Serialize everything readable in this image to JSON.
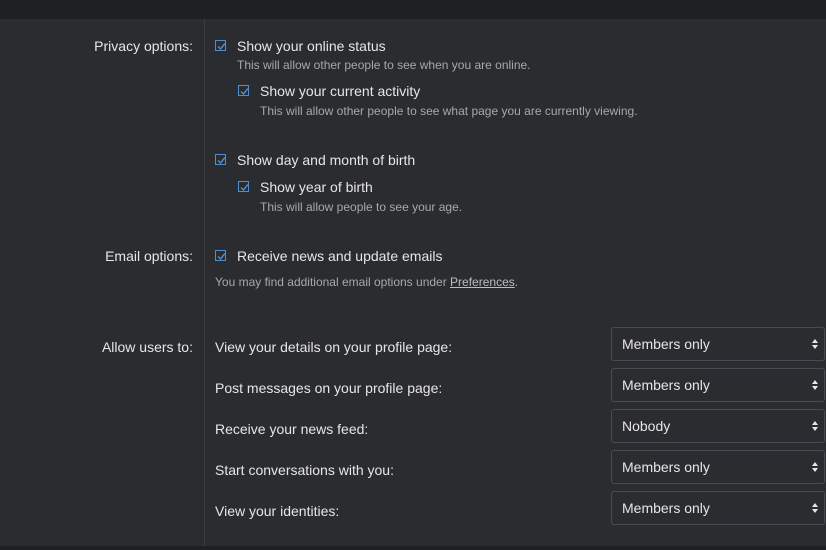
{
  "privacy": {
    "label": "Privacy options:",
    "online_status": "Show your online status",
    "online_status_hint": "This will allow other people to see when you are online.",
    "current_activity": "Show your current activity",
    "current_activity_hint": "This will allow other people to see what page you are currently viewing.",
    "dob": "Show day and month of birth",
    "year": "Show year of birth",
    "year_hint": "This will allow people to see your age."
  },
  "email": {
    "label": "Email options:",
    "news": "Receive news and update emails",
    "hint_prefix": "You may find additional email options under ",
    "hint_link": "Preferences",
    "hint_suffix": "."
  },
  "allow": {
    "label": "Allow users to:",
    "rows": [
      {
        "label": "View your details on your profile page:",
        "value": "Members only"
      },
      {
        "label": "Post messages on your profile page:",
        "value": "Members only"
      },
      {
        "label": "Receive your news feed:",
        "value": "Nobody"
      },
      {
        "label": "Start conversations with you:",
        "value": "Members only"
      },
      {
        "label": "View your identities:",
        "value": "Members only"
      }
    ]
  },
  "colors": {
    "accent": "#4f8fd1",
    "background": "#2b2c30",
    "text": "#e6e6e6",
    "hint": "#a8a8a8"
  },
  "checkbox_state": {
    "online_status": true,
    "current_activity": true,
    "dob": true,
    "year": true,
    "news": true
  }
}
